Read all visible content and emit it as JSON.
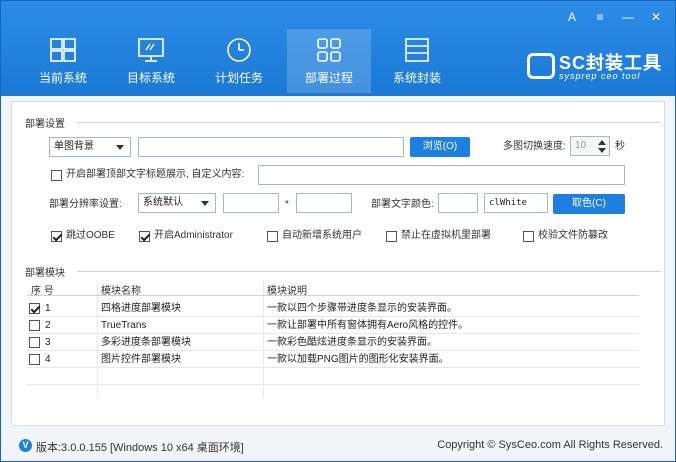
{
  "window_controls": [
    "A",
    "≡",
    "—",
    "✕"
  ],
  "nav": {
    "tabs": [
      {
        "label": "当前系统",
        "icon": "windows-icon"
      },
      {
        "label": "目标系统",
        "icon": "monitor-icon"
      },
      {
        "label": "计划任务",
        "icon": "clock-icon"
      },
      {
        "label": "部署过程",
        "icon": "modules-icon"
      },
      {
        "label": "系统封装",
        "icon": "package-icon"
      }
    ],
    "active": "部署过程"
  },
  "logo": {
    "title": "SC封装工具",
    "subtitle": "sysprep ceo tool"
  },
  "deploy_settings": {
    "section_title": "部署设置",
    "background_select": "单图背景",
    "background_path": "",
    "browse_label": "浏览(O)",
    "switch_speed_label": "多图切换速度:",
    "switch_speed_value": "10",
    "switch_speed_unit": "秒",
    "top_text_checkbox": "开启部署顶部文字标题展示, 自定义内容:",
    "top_text_value": "",
    "resolution_label": "部署分辨率设置:",
    "resolution_select": "系统默认",
    "resolution_w": "",
    "resolution_sep": "*",
    "resolution_h": "",
    "text_color_label": "部署文字颜色:",
    "text_color_value": "clWhite",
    "pick_color_label": "取色(C)",
    "options": [
      {
        "label": "跳过OOBE",
        "checked": true
      },
      {
        "label": "开启Administrator",
        "checked": true
      },
      {
        "label": "自动新增系统用户",
        "checked": false
      },
      {
        "label": "禁止在虚拟机里部署",
        "checked": false
      },
      {
        "label": "校验文件防篡改",
        "checked": false
      }
    ]
  },
  "modules": {
    "section_title": "部署模块",
    "columns": [
      "序 号",
      "模块名称",
      "模块说明"
    ],
    "rows": [
      {
        "no": "1",
        "name": "四格进度部署模块",
        "desc": "一款以四个步骤带进度条显示的安装界面。",
        "checked": true
      },
      {
        "no": "2",
        "name": "TrueTrans",
        "desc": "一款让部署中所有窗体拥有Aero风格的控件。",
        "checked": false
      },
      {
        "no": "3",
        "name": "多彩进度条部署模块",
        "desc": "一款彩色酷炫进度条显示的安装界面。",
        "checked": false
      },
      {
        "no": "4",
        "name": "图片控件部署模块",
        "desc": "一款以加载PNG图片的图形化安装界面。",
        "checked": false
      }
    ]
  },
  "status": {
    "badge": "V",
    "version": "版本:3.0.0.155 [Windows 10 x64 桌面环境]",
    "copyright": "Copyright © SysCeo.com All Rights Reserved."
  }
}
